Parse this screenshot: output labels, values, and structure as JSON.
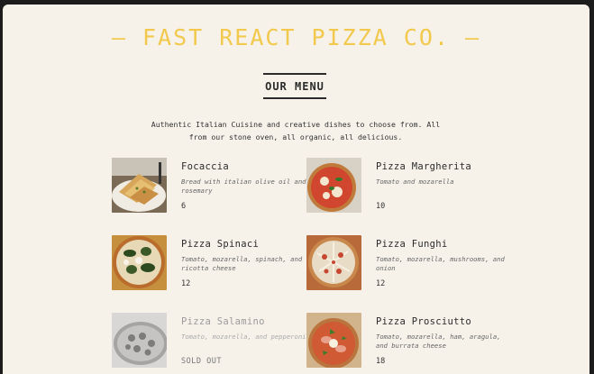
{
  "header": {
    "title": "— FAST REACT PIZZA CO. —"
  },
  "menu": {
    "heading": "OUR MENU",
    "tagline": "Authentic Italian Cuisine and creative dishes to choose from. All from our stone oven, all organic, all delicious."
  },
  "items": [
    {
      "name": "Focaccia",
      "description": "Bread with italian olive oil and rosemary",
      "price": "6"
    },
    {
      "name": "Pizza Margherita",
      "description": "Tomato and mozarella",
      "price": "10"
    },
    {
      "name": "Pizza Spinaci",
      "description": "Tomato, mozarella, spinach, and ricotta cheese",
      "price": "12"
    },
    {
      "name": "Pizza Funghi",
      "description": "Tomato, mozarella, mushrooms, and onion",
      "price": "12"
    },
    {
      "name": "Pizza Salamino",
      "description": "Tomato, mozarella, and pepperoni",
      "price": "SOLD OUT"
    },
    {
      "name": "Pizza Prosciutto",
      "description": "Tomato, mozarella, ham, aragula, and burrata cheese",
      "price": "18"
    }
  ]
}
